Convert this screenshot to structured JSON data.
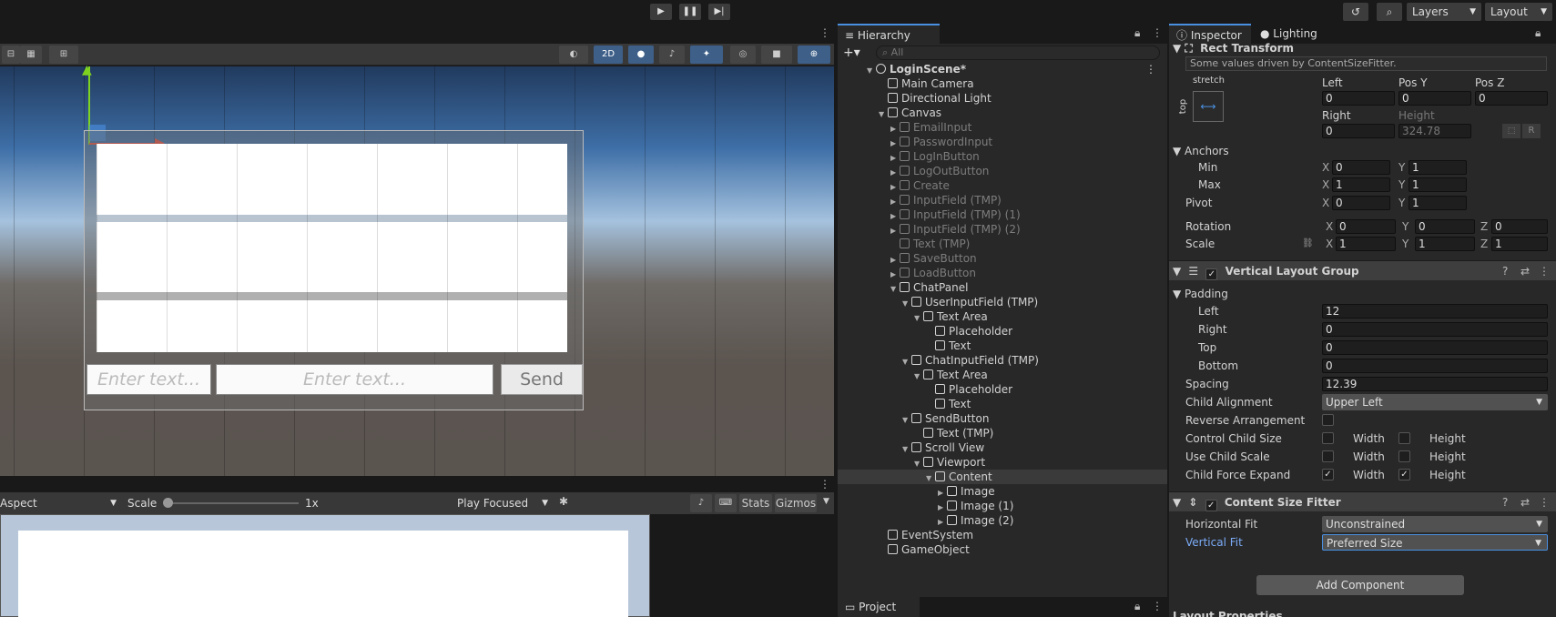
{
  "toolbar": {
    "layers": "Layers",
    "layout": "Layout"
  },
  "scene": {
    "mode_2d": "2D",
    "input_placeholder": "Enter text...",
    "send_label": "Send"
  },
  "game": {
    "aspect": "Aspect",
    "scale_label": "Scale",
    "scale_value": "1x",
    "play_focused": "Play Focused",
    "stats": "Stats",
    "gizmos": "Gizmos"
  },
  "hierarchy": {
    "title": "Hierarchy",
    "search_placeholder": "All",
    "project_tab": "Project",
    "items": [
      {
        "label": "LoginScene*",
        "depth": 0,
        "arrow": "▼",
        "dim": false,
        "scene": true
      },
      {
        "label": "Main Camera",
        "depth": 1,
        "arrow": "",
        "dim": false
      },
      {
        "label": "Directional Light",
        "depth": 1,
        "arrow": "",
        "dim": false
      },
      {
        "label": "Canvas",
        "depth": 1,
        "arrow": "▼",
        "dim": false
      },
      {
        "label": "EmailInput",
        "depth": 2,
        "arrow": "▶",
        "dim": true
      },
      {
        "label": "PasswordInput",
        "depth": 2,
        "arrow": "▶",
        "dim": true
      },
      {
        "label": "LogInButton",
        "depth": 2,
        "arrow": "▶",
        "dim": true
      },
      {
        "label": "LogOutButton",
        "depth": 2,
        "arrow": "▶",
        "dim": true
      },
      {
        "label": "Create",
        "depth": 2,
        "arrow": "▶",
        "dim": true
      },
      {
        "label": "InputField (TMP)",
        "depth": 2,
        "arrow": "▶",
        "dim": true
      },
      {
        "label": "InputField (TMP) (1)",
        "depth": 2,
        "arrow": "▶",
        "dim": true
      },
      {
        "label": "InputField (TMP) (2)",
        "depth": 2,
        "arrow": "▶",
        "dim": true
      },
      {
        "label": "Text (TMP)",
        "depth": 2,
        "arrow": "",
        "dim": true
      },
      {
        "label": "SaveButton",
        "depth": 2,
        "arrow": "▶",
        "dim": true
      },
      {
        "label": "LoadButton",
        "depth": 2,
        "arrow": "▶",
        "dim": true
      },
      {
        "label": "ChatPanel",
        "depth": 2,
        "arrow": "▼",
        "dim": false
      },
      {
        "label": "UserInputField (TMP)",
        "depth": 3,
        "arrow": "▼",
        "dim": false
      },
      {
        "label": "Text Area",
        "depth": 4,
        "arrow": "▼",
        "dim": false
      },
      {
        "label": "Placeholder",
        "depth": 5,
        "arrow": "",
        "dim": false
      },
      {
        "label": "Text",
        "depth": 5,
        "arrow": "",
        "dim": false
      },
      {
        "label": "ChatInputField (TMP)",
        "depth": 3,
        "arrow": "▼",
        "dim": false
      },
      {
        "label": "Text Area",
        "depth": 4,
        "arrow": "▼",
        "dim": false
      },
      {
        "label": "Placeholder",
        "depth": 5,
        "arrow": "",
        "dim": false
      },
      {
        "label": "Text",
        "depth": 5,
        "arrow": "",
        "dim": false
      },
      {
        "label": "SendButton",
        "depth": 3,
        "arrow": "▼",
        "dim": false
      },
      {
        "label": "Text (TMP)",
        "depth": 4,
        "arrow": "",
        "dim": false
      },
      {
        "label": "Scroll View",
        "depth": 3,
        "arrow": "▼",
        "dim": false
      },
      {
        "label": "Viewport",
        "depth": 4,
        "arrow": "▼",
        "dim": false
      },
      {
        "label": "Content",
        "depth": 5,
        "arrow": "▼",
        "dim": false,
        "selected": true
      },
      {
        "label": "Image",
        "depth": 6,
        "arrow": "▶",
        "dim": false
      },
      {
        "label": "Image (1)",
        "depth": 6,
        "arrow": "▶",
        "dim": false
      },
      {
        "label": "Image (2)",
        "depth": 6,
        "arrow": "▶",
        "dim": false
      },
      {
        "label": "EventSystem",
        "depth": 1,
        "arrow": "",
        "dim": false
      },
      {
        "label": "GameObject",
        "depth": 1,
        "arrow": "",
        "dim": false
      }
    ]
  },
  "inspector": {
    "tab": "Inspector",
    "lighting_tab": "Lighting",
    "rect": {
      "title": "Rect Transform",
      "note": "Some values driven by ContentSizeFitter.",
      "anchor_preset": "stretch",
      "anchor_side": "top",
      "left_label": "Left",
      "left": "0",
      "posy_label": "Pos Y",
      "posy": "0",
      "posz_label": "Pos Z",
      "posz": "0",
      "right_label": "Right",
      "right": "0",
      "height_label": "Height",
      "height": "324.78",
      "r_btn": "R",
      "anchors": "Anchors",
      "min": "Min",
      "min_x": "0",
      "min_y": "1",
      "max": "Max",
      "max_x": "1",
      "max_y": "1",
      "pivot": "Pivot",
      "pivot_x": "0",
      "pivot_y": "1",
      "rotation": "Rotation",
      "rot_x": "0",
      "rot_y": "0",
      "rot_z": "0",
      "scale": "Scale",
      "scale_x": "1",
      "scale_y": "1",
      "scale_z": "1"
    },
    "vlg": {
      "title": "Vertical Layout Group",
      "padding": "Padding",
      "left": "Left",
      "left_v": "12",
      "right": "Right",
      "right_v": "0",
      "top": "Top",
      "top_v": "0",
      "bottom": "Bottom",
      "bottom_v": "0",
      "spacing": "Spacing",
      "spacing_v": "12.39",
      "child_alignment": "Child Alignment",
      "child_alignment_v": "Upper Left",
      "reverse": "Reverse Arrangement",
      "control_child_size": "Control Child Size",
      "use_child_scale": "Use Child Scale",
      "child_force_expand": "Child Force Expand",
      "width": "Width",
      "height": "Height"
    },
    "csf": {
      "title": "Content Size Fitter",
      "horizontal": "Horizontal Fit",
      "horizontal_v": "Unconstrained",
      "vertical": "Vertical Fit",
      "vertical_v": "Preferred Size"
    },
    "add_component": "Add Component",
    "layout_properties": "Layout Properties"
  },
  "axes": {
    "x": "X",
    "y": "Y",
    "z": "Z"
  },
  "colors": {
    "accent": "#4a90e2",
    "selection": "#3d5f88"
  }
}
